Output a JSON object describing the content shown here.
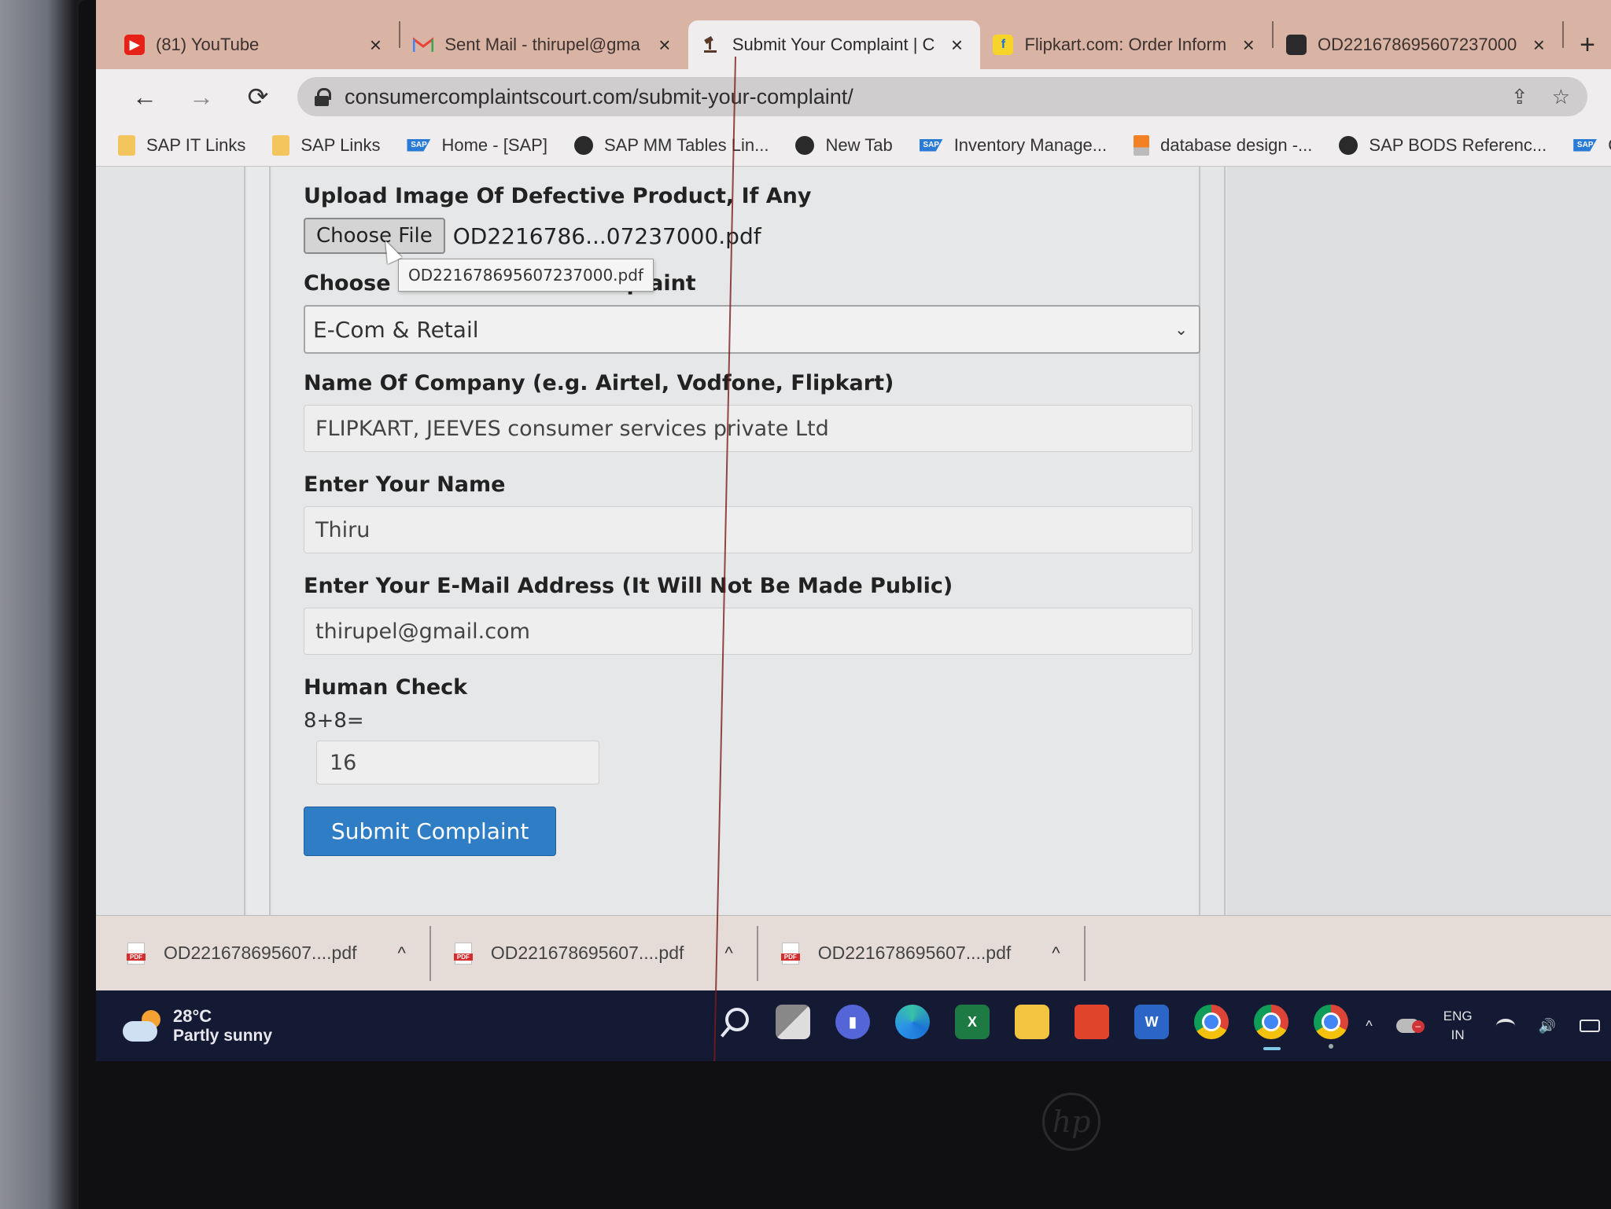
{
  "browser": {
    "tabs": [
      {
        "title": "(81) YouTube",
        "favicon": "youtube-icon",
        "active": false
      },
      {
        "title": "Sent Mail - thirupel@gma",
        "favicon": "gmail-icon",
        "active": false
      },
      {
        "title": "Submit Your Complaint | C",
        "favicon": "gavel-icon",
        "active": true
      },
      {
        "title": "Flipkart.com: Order Inform",
        "favicon": "flipkart-icon",
        "active": false
      },
      {
        "title": "OD221678695607237000",
        "favicon": "globe-icon",
        "active": false
      }
    ],
    "close_glyph": "×",
    "new_tab_glyph": "+",
    "nav": {
      "back": "←",
      "forward": "→",
      "reload": "⟳"
    },
    "url": "consumercomplaintscourt.com/submit-your-complaint/",
    "omni_actions": {
      "share": "⇪",
      "bookmark": "☆"
    },
    "bookmarks": [
      {
        "label": "SAP IT Links",
        "icon": "folder"
      },
      {
        "label": "SAP Links",
        "icon": "folder"
      },
      {
        "label": "Home - [SAP]",
        "icon": "sap"
      },
      {
        "label": "SAP MM Tables Lin...",
        "icon": "globe"
      },
      {
        "label": "New Tab",
        "icon": "globe"
      },
      {
        "label": "Inventory Manage...",
        "icon": "sap"
      },
      {
        "label": "database design -...",
        "icon": "stackoverflow"
      },
      {
        "label": "SAP BODS Referenc...",
        "icon": "globe"
      },
      {
        "label": "Convertion funct",
        "icon": "sap"
      }
    ]
  },
  "form": {
    "upload": {
      "label": "Upload Image Of Defective Product, If Any",
      "button": "Choose File",
      "filename": "OD2216786...07237000.pdf",
      "tooltip": "OD221678695607237000.pdf"
    },
    "category": {
      "label_visible_start": "Choose",
      "label_visible_end": "plaint",
      "selected": "E-Com & Retail",
      "chevron": "⌄"
    },
    "company": {
      "label": "Name Of Company (e.g. Airtel, Vodfone, Flipkart)",
      "value": "FLIPKART, JEEVES consumer services private Ltd"
    },
    "name": {
      "label": "Enter Your Name",
      "value": "Thiru"
    },
    "email": {
      "label": "Enter Your E-Mail Address (It Will Not Be Made Public)",
      "value": "thirupel@gmail.com"
    },
    "human_check": {
      "label": "Human Check",
      "question": "8+8=",
      "answer": "16"
    },
    "submit_label": "Submit Complaint"
  },
  "downloads": [
    {
      "name": "OD221678695607....pdf"
    },
    {
      "name": "OD221678695607....pdf"
    },
    {
      "name": "OD221678695607....pdf"
    }
  ],
  "downloads_chevron": "^",
  "taskbar": {
    "weather": {
      "temp": "28°C",
      "condition": "Partly sunny"
    },
    "apps": [
      "start",
      "search",
      "task-view",
      "teams-chat",
      "edge",
      "excel",
      "file-explorer",
      "office",
      "word",
      "chrome",
      "chrome-profile",
      "chrome-profile-2"
    ],
    "tray": {
      "overflow": "^",
      "lang_line1": "ENG",
      "lang_line2": "IN"
    }
  },
  "device": {
    "brand": "hp"
  },
  "colors": {
    "submit_button": "#2f7dc5",
    "tab_strip": "#d9b3a3",
    "taskbar": "#141a33"
  }
}
